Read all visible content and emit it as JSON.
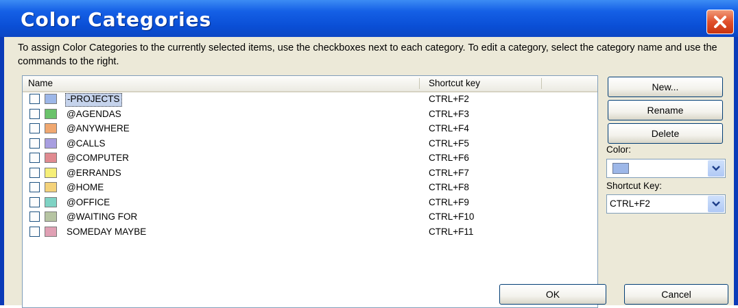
{
  "window": {
    "title": "Color Categories"
  },
  "description": "To assign Color Categories to the currently selected items, use the checkboxes next to each category.  To edit a category, select the category name and use the commands to the right.",
  "list": {
    "columns": {
      "name": "Name",
      "shortcut": "Shortcut key"
    },
    "rows": [
      {
        "name": "-PROJECTS",
        "shortcut": "CTRL+F2",
        "color": "#9db7e8",
        "checked": false,
        "selected": true
      },
      {
        "name": "@AGENDAS",
        "shortcut": "CTRL+F3",
        "color": "#6ac26a",
        "checked": false,
        "selected": false
      },
      {
        "name": "@ANYWHERE",
        "shortcut": "CTRL+F4",
        "color": "#f0a870",
        "checked": false,
        "selected": false
      },
      {
        "name": "@CALLS",
        "shortcut": "CTRL+F5",
        "color": "#a89ee0",
        "checked": false,
        "selected": false
      },
      {
        "name": "@COMPUTER",
        "shortcut": "CTRL+F6",
        "color": "#e08a90",
        "checked": false,
        "selected": false
      },
      {
        "name": "@ERRANDS",
        "shortcut": "CTRL+F7",
        "color": "#f6ef78",
        "checked": false,
        "selected": false
      },
      {
        "name": "@HOME",
        "shortcut": "CTRL+F8",
        "color": "#f4d27a",
        "checked": false,
        "selected": false
      },
      {
        "name": "@OFFICE",
        "shortcut": "CTRL+F9",
        "color": "#7fd3c4",
        "checked": false,
        "selected": false
      },
      {
        "name": "@WAITING FOR",
        "shortcut": "CTRL+F10",
        "color": "#b6c4a2",
        "checked": false,
        "selected": false
      },
      {
        "name": "SOMEDAY MAYBE",
        "shortcut": "CTRL+F11",
        "color": "#e0a0b4",
        "checked": false,
        "selected": false
      }
    ]
  },
  "side": {
    "new_label": "New...",
    "rename_label": "Rename",
    "delete_label": "Delete",
    "color_label": "Color:",
    "color_value": "#9db7e8",
    "shortcut_label": "Shortcut Key:",
    "shortcut_value": "CTRL+F2"
  },
  "footer": {
    "ok_label": "OK",
    "cancel_label": "Cancel"
  },
  "icons": {
    "close": "close-icon",
    "dropdown": "chevron-down-icon"
  }
}
